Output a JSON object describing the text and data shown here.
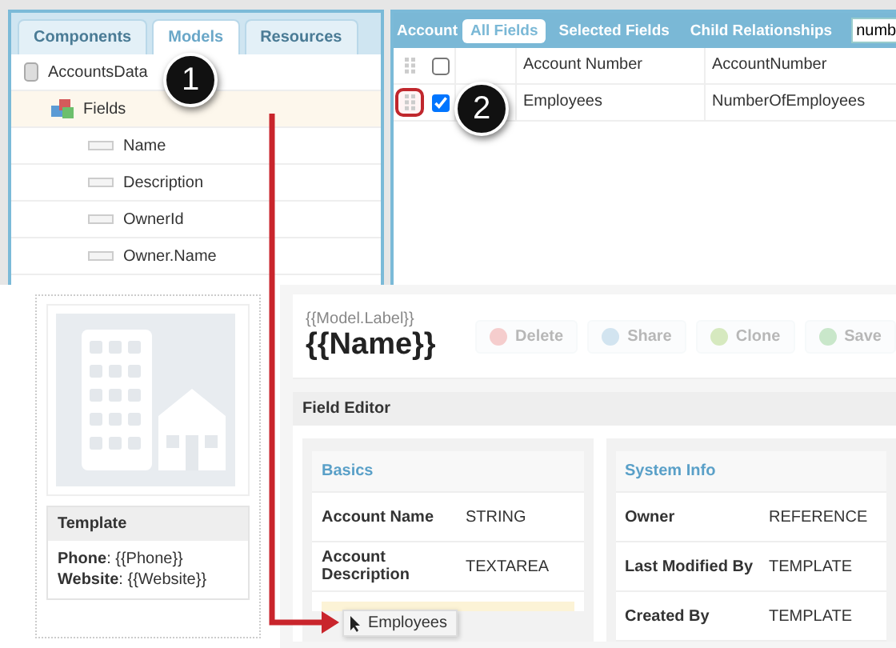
{
  "toolbox": {
    "tabs": [
      {
        "label": "Components",
        "selected": false
      },
      {
        "label": "Models",
        "selected": true
      },
      {
        "label": "Resources",
        "selected": false
      }
    ],
    "tree": [
      {
        "label": "AccountsData",
        "kind": "model",
        "selected": false,
        "children": [
          {
            "label": "Fields",
            "kind": "folder",
            "selected": true,
            "children": [
              {
                "label": "Name",
                "kind": "field",
                "selected": false
              },
              {
                "label": "Description",
                "kind": "field",
                "selected": false
              },
              {
                "label": "OwnerId",
                "kind": "field",
                "selected": false
              },
              {
                "label": "Owner.Name",
                "kind": "field",
                "selected": false
              }
            ]
          }
        ]
      }
    ]
  },
  "field_browser": {
    "object_label": "Account",
    "tabs": [
      {
        "label": "All Fields",
        "selected": true
      },
      {
        "label": "Selected Fields",
        "selected": false
      },
      {
        "label": "Child Relationships",
        "selected": false
      }
    ],
    "search": {
      "value": "numb"
    },
    "rows": [
      {
        "label": "Account Number",
        "api_name": "AccountNumber",
        "checked": false,
        "highlighted": false
      },
      {
        "label": "Employees",
        "api_name": "NumberOfEmployees",
        "checked": true,
        "highlighted": true
      }
    ]
  },
  "record_card": {
    "template": {
      "title": "Template",
      "lines": [
        "**Phone**: {{Phone}}",
        "**Website**: {{Website}}"
      ]
    }
  },
  "record_header": {
    "label": "{{Model.Label}}",
    "name": "{{Name}}",
    "buttons": [
      {
        "label": "Delete",
        "kind": "delete",
        "disabled": true
      },
      {
        "label": "Share",
        "kind": "share",
        "disabled": true
      },
      {
        "label": "Clone",
        "kind": "clone",
        "disabled": true
      },
      {
        "label": "Save",
        "kind": "save",
        "disabled": true
      }
    ]
  },
  "field_editor": {
    "title": "Field Editor",
    "sections": [
      {
        "title": "Basics",
        "drop_target": true,
        "rows": [
          {
            "label": "Account Name",
            "value": "STRING"
          },
          {
            "label": "Account Description",
            "value": "TEXTAREA"
          }
        ]
      },
      {
        "title": "System Info",
        "drop_target": false,
        "rows": [
          {
            "label": "Owner",
            "value": "REFERENCE"
          },
          {
            "label": "Last Modified By",
            "value": "TEMPLATE"
          },
          {
            "label": "Created By",
            "value": "TEMPLATE"
          }
        ]
      }
    ]
  },
  "callouts": [
    {
      "number": "1"
    },
    {
      "number": "2"
    }
  ],
  "drag_ghost": {
    "label": "Employees"
  }
}
